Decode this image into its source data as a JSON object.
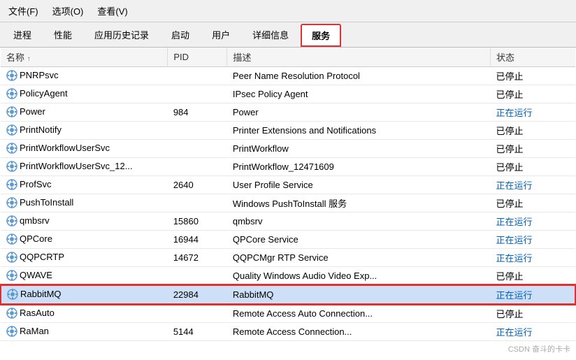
{
  "menu": {
    "items": [
      "文件(F)",
      "选项(O)",
      "查看(V)"
    ]
  },
  "tabs": [
    {
      "label": "进程",
      "active": false
    },
    {
      "label": "性能",
      "active": false
    },
    {
      "label": "应用历史记录",
      "active": false
    },
    {
      "label": "启动",
      "active": false
    },
    {
      "label": "用户",
      "active": false
    },
    {
      "label": "详细信息",
      "active": false
    },
    {
      "label": "服务",
      "active": true
    }
  ],
  "columns": [
    {
      "label": "名称",
      "sort": "↑"
    },
    {
      "label": "PID"
    },
    {
      "label": "描述"
    },
    {
      "label": "状态"
    }
  ],
  "rows": [
    {
      "name": "PNRPsvc",
      "pid": "",
      "desc": "Peer Name Resolution Protocol",
      "status": "已停止",
      "running": false,
      "selected": false
    },
    {
      "name": "PolicyAgent",
      "pid": "",
      "desc": "IPsec Policy Agent",
      "status": "已停止",
      "running": false,
      "selected": false
    },
    {
      "name": "Power",
      "pid": "984",
      "desc": "Power",
      "status": "正在运行",
      "running": true,
      "selected": false
    },
    {
      "name": "PrintNotify",
      "pid": "",
      "desc": "Printer Extensions and Notifications",
      "status": "已停止",
      "running": false,
      "selected": false
    },
    {
      "name": "PrintWorkflowUserSvc",
      "pid": "",
      "desc": "PrintWorkflow",
      "status": "已停止",
      "running": false,
      "selected": false
    },
    {
      "name": "PrintWorkflowUserSvc_12...",
      "pid": "",
      "desc": "PrintWorkflow_12471609",
      "status": "已停止",
      "running": false,
      "selected": false
    },
    {
      "name": "ProfSvc",
      "pid": "2640",
      "desc": "User Profile Service",
      "status": "正在运行",
      "running": true,
      "selected": false
    },
    {
      "name": "PushToInstall",
      "pid": "",
      "desc": "Windows PushToInstall 服务",
      "status": "已停止",
      "running": false,
      "selected": false
    },
    {
      "name": "qmbsrv",
      "pid": "15860",
      "desc": "qmbsrv",
      "status": "正在运行",
      "running": true,
      "selected": false
    },
    {
      "name": "QPCore",
      "pid": "16944",
      "desc": "QPCore Service",
      "status": "正在运行",
      "running": true,
      "selected": false
    },
    {
      "name": "QQPCRTP",
      "pid": "14672",
      "desc": "QQPCMgr RTP Service",
      "status": "正在运行",
      "running": true,
      "selected": false
    },
    {
      "name": "QWAVE",
      "pid": "",
      "desc": "Quality Windows Audio Video Exp...",
      "status": "已停止",
      "running": false,
      "selected": false
    },
    {
      "name": "RabbitMQ",
      "pid": "22984",
      "desc": "RabbitMQ",
      "status": "正在运行",
      "running": true,
      "selected": true
    },
    {
      "name": "RasAuto",
      "pid": "",
      "desc": "Remote Access Auto Connection...",
      "status": "已停止",
      "running": false,
      "selected": false
    },
    {
      "name": "RaMan",
      "pid": "5144",
      "desc": "Remote Access Connection...",
      "status": "正在运行",
      "running": true,
      "selected": false
    }
  ],
  "watermark": "CSDN 奋斗的卡卡"
}
